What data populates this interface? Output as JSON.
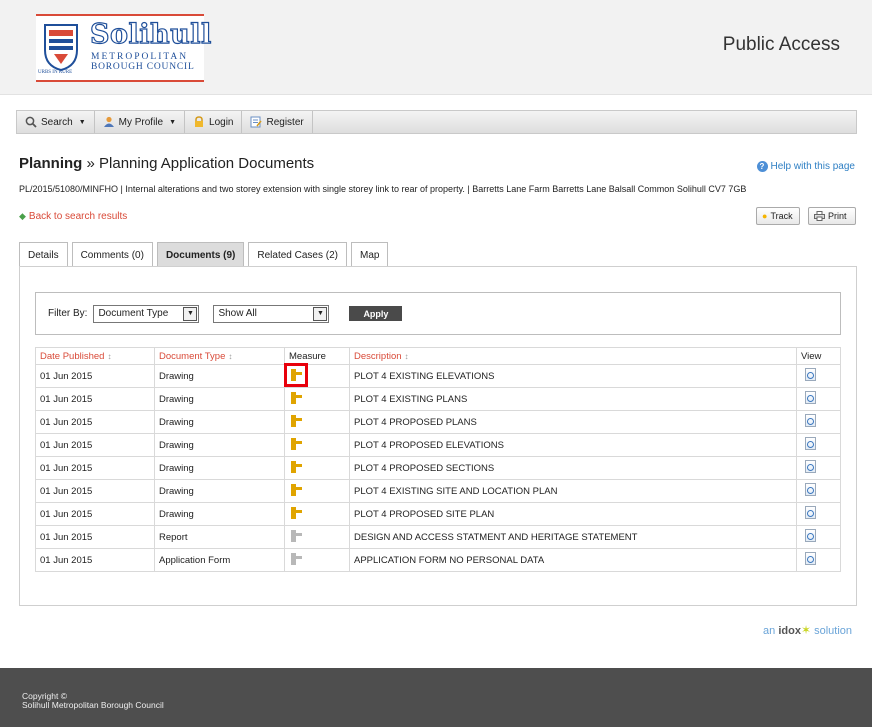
{
  "header": {
    "logo": {
      "name": "Solihull",
      "line1": "METROPOLITAN",
      "line2": "BOROUGH COUNCIL",
      "motto": "URBS IN RURE"
    },
    "title": "Public Access"
  },
  "toolbar": {
    "search": "Search",
    "my_profile": "My Profile",
    "login": "Login",
    "register": "Register"
  },
  "page": {
    "section": "Planning",
    "separator": "»",
    "title": "Planning Application Documents",
    "help": "Help with this page",
    "description": "PL/2015/51080/MINFHO | Internal alterations and two storey extension with single storey link to rear of property. | Barretts Lane Farm Barretts Lane Balsall Common Solihull CV7 7GB",
    "back": "Back to search results",
    "track": "Track",
    "print": "Print"
  },
  "tabs": [
    {
      "label": "Details"
    },
    {
      "label": "Comments (0)"
    },
    {
      "label": "Documents (9)"
    },
    {
      "label": "Related Cases (2)"
    },
    {
      "label": "Map"
    }
  ],
  "filter": {
    "label": "Filter By:",
    "type_value": "Document Type",
    "show_value": "Show All",
    "apply": "Apply"
  },
  "table": {
    "headers": {
      "date": "Date Published",
      "type": "Document Type",
      "measure": "Measure",
      "description": "Description",
      "view": "View"
    },
    "rows": [
      {
        "date": "01 Jun 2015",
        "type": "Drawing",
        "measure": "gold",
        "description": "PLOT 4 EXISTING ELEVATIONS"
      },
      {
        "date": "01 Jun 2015",
        "type": "Drawing",
        "measure": "gold",
        "description": "PLOT 4 EXISTING PLANS"
      },
      {
        "date": "01 Jun 2015",
        "type": "Drawing",
        "measure": "gold",
        "description": "PLOT 4 PROPOSED PLANS"
      },
      {
        "date": "01 Jun 2015",
        "type": "Drawing",
        "measure": "gold",
        "description": "PLOT 4 PROPOSED ELEVATIONS"
      },
      {
        "date": "01 Jun 2015",
        "type": "Drawing",
        "measure": "gold",
        "description": "PLOT 4 PROPOSED SECTIONS"
      },
      {
        "date": "01 Jun 2015",
        "type": "Drawing",
        "measure": "gold",
        "description": "PLOT 4 EXISTING SITE AND LOCATION PLAN"
      },
      {
        "date": "01 Jun 2015",
        "type": "Drawing",
        "measure": "gold",
        "description": "PLOT 4 PROPOSED SITE PLAN"
      },
      {
        "date": "01 Jun 2015",
        "type": "Report",
        "measure": "grey",
        "description": "DESIGN AND ACCESS STATMENT AND HERITAGE STATEMENT"
      },
      {
        "date": "01 Jun 2015",
        "type": "Application Form",
        "measure": "grey",
        "description": "APPLICATION FORM NO PERSONAL DATA"
      }
    ]
  },
  "branding": {
    "prefix": "an",
    "brand": "idox",
    "suffix": "solution"
  },
  "footer": {
    "line1": "Copyright ©",
    "line2": "Solihull Metropolitan Borough Council"
  }
}
